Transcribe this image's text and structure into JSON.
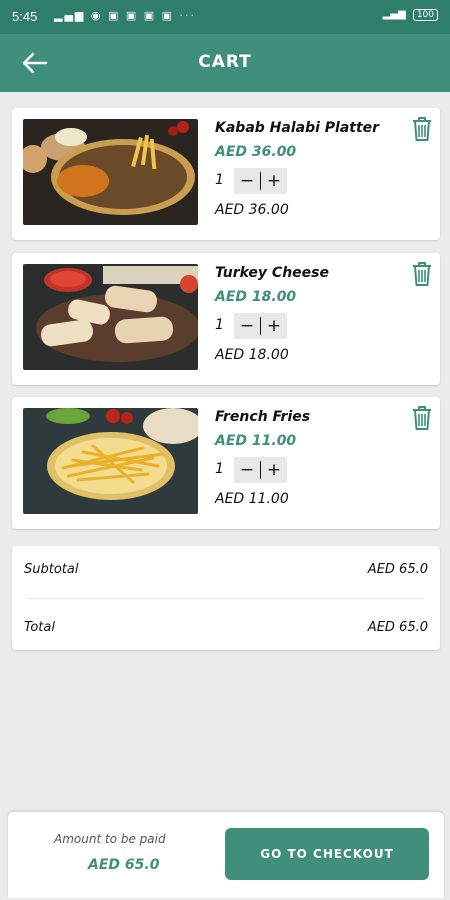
{
  "status": {
    "time": "5:45",
    "battery": "100"
  },
  "header": {
    "title": "CART"
  },
  "items": [
    {
      "name": "Kabab Halabi Platter",
      "price": "AED 36.00",
      "qty": "1",
      "minus": "−",
      "plus": "+",
      "total": "AED 36.00",
      "image": "kabab-platter-image"
    },
    {
      "name": "Turkey Cheese",
      "price": "AED 18.00",
      "qty": "1",
      "minus": "−",
      "plus": "+",
      "total": "AED 18.00",
      "image": "turkey-cheese-wraps-image"
    },
    {
      "name": "French Fries",
      "price": "AED 11.00",
      "qty": "1",
      "minus": "−",
      "plus": "+",
      "total": "AED 11.00",
      "image": "french-fries-image"
    }
  ],
  "summary": {
    "subtotal_label": "Subtotal",
    "subtotal_value": "AED 65.0",
    "total_label": "Total",
    "total_value": "AED 65.0"
  },
  "footer": {
    "amount_label": "Amount to be paid",
    "amount_value": "AED 65.0",
    "checkout_label": "GO TO CHECKOUT"
  },
  "colors": {
    "primary": "#3f8f7c",
    "status_bar": "#2f7e6c",
    "background": "#ebebeb"
  }
}
